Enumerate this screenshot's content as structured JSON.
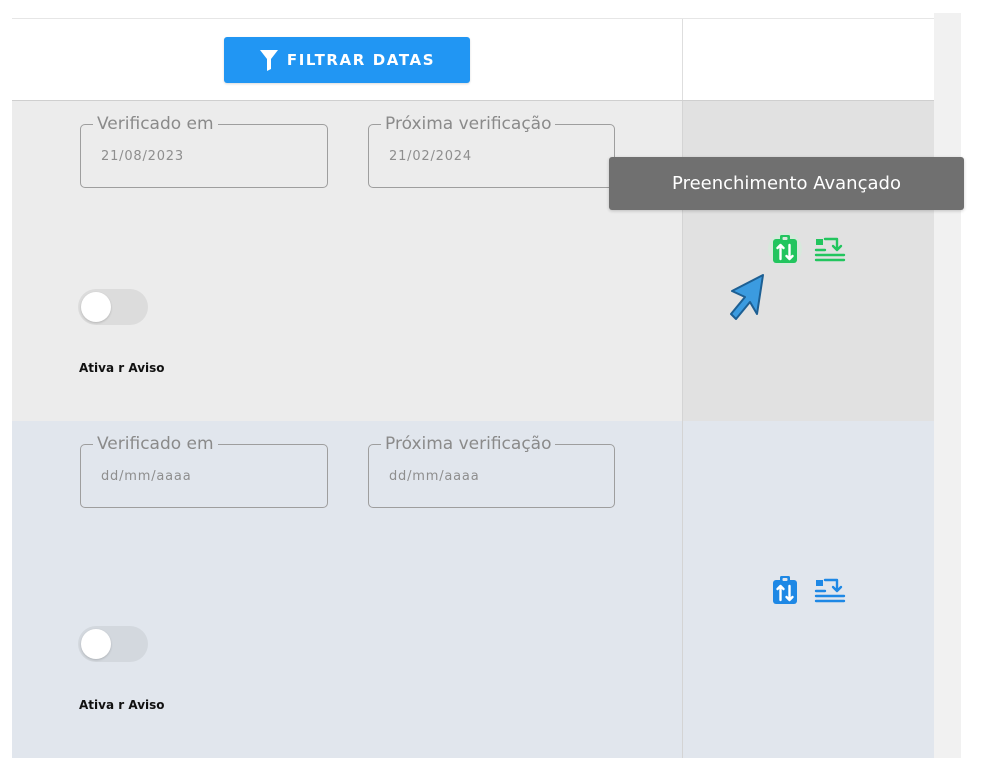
{
  "toolbar": {
    "filter_button_label": "FILTRAR DATAS",
    "filter_icon": "filter-icon"
  },
  "rows": [
    {
      "verified_label": "Verificado em",
      "verified_value": "21/08/2023",
      "next_label": "Próxima verificação",
      "next_value": "21/02/2024",
      "toggle_label": "Ativa r Aviso",
      "toggle_on": false,
      "icon_color": "#22c55e",
      "icons": [
        "advanced-fill-icon",
        "batch-fill-icon"
      ]
    },
    {
      "verified_label": "Verificado em",
      "verified_placeholder": "dd/mm/aaaa",
      "next_label": "Próxima verificação",
      "next_placeholder": "dd/mm/aaaa",
      "toggle_label": "Ativa r Aviso",
      "toggle_on": false,
      "icon_color": "#1e88e5",
      "icons": [
        "advanced-fill-icon",
        "batch-fill-icon"
      ]
    }
  ],
  "tooltip": {
    "text": "Preenchimento Avançado"
  },
  "colors": {
    "primary": "#2196f3",
    "success": "#22c55e",
    "tooltip_bg": "#707070",
    "cursor": "#3b9be0"
  }
}
